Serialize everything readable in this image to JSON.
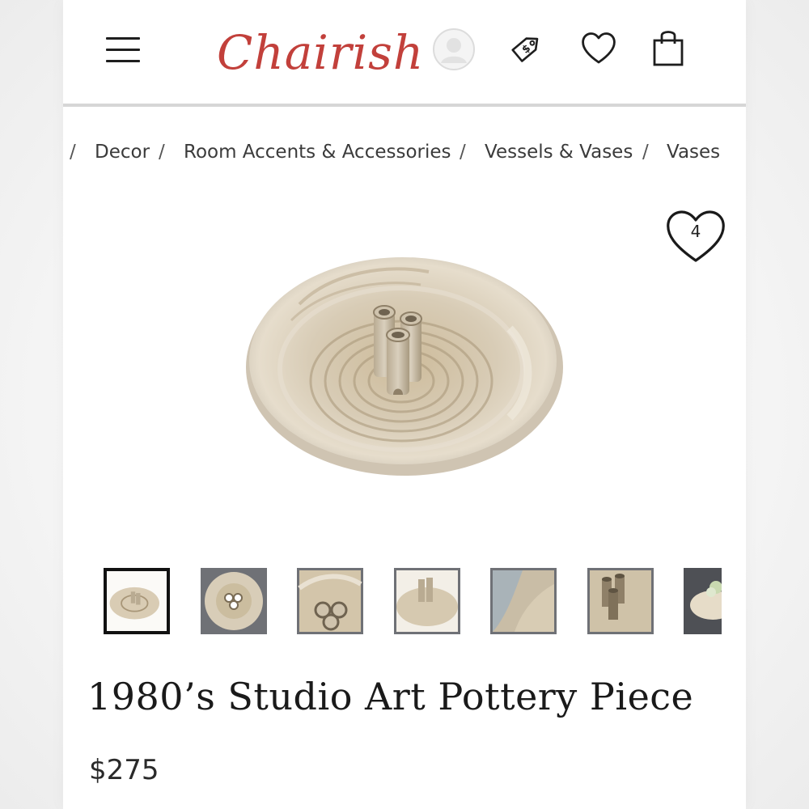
{
  "header": {
    "logo_text": "Chairish",
    "brand_color": "#c2403b",
    "icons": [
      "menu-icon",
      "user-avatar-icon",
      "price-tag-icon",
      "heart-icon",
      "shopping-bag-icon"
    ]
  },
  "breadcrumb": {
    "items": [
      "Decor",
      "Room Accents & Accessories",
      "Vessels & Vases",
      "Vases"
    ]
  },
  "product": {
    "favorite_count": "4",
    "title": "1980’s Studio Art Pottery Piece",
    "price": "$275",
    "thumbnail_count": 7,
    "selected_thumbnail": 1
  }
}
